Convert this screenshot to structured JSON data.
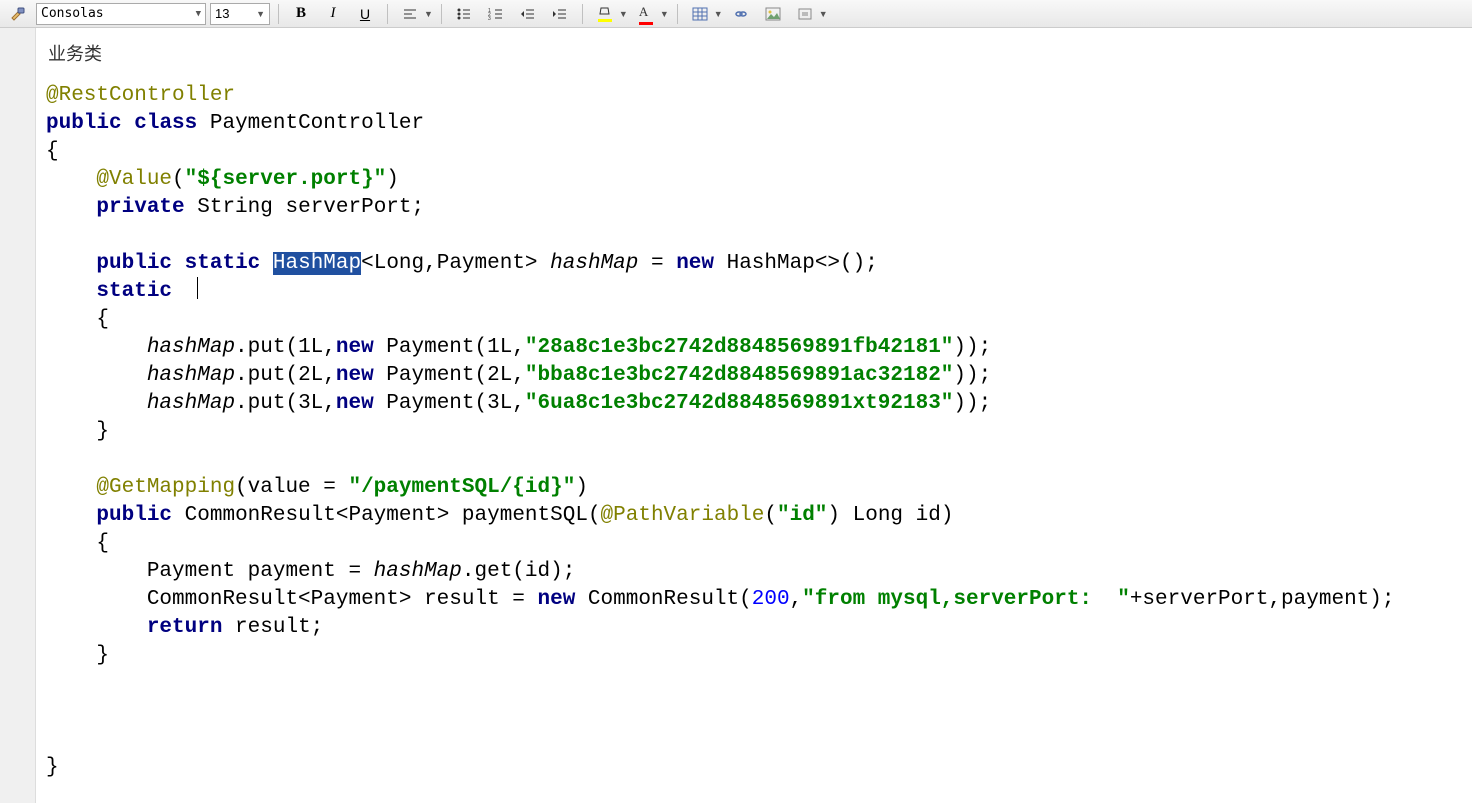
{
  "toolbar": {
    "font": "Consolas",
    "size": "13",
    "bold": "B",
    "italic": "I",
    "underline": "U"
  },
  "tab": "业务类",
  "code": {
    "annotation_rest": "@RestController",
    "kw_public": "public",
    "kw_class": "class",
    "class_name": "PaymentController",
    "brace_open": "{",
    "annotation_value": "@Value",
    "value_arg_open": "(",
    "value_str": "\"${server.port}\"",
    "value_arg_close": ")",
    "kw_private": "private",
    "type_string": "String",
    "field_serverPort": "serverPort;",
    "kw_static": "static",
    "type_hashmap": "HashMap",
    "generic": "<Long,Payment>",
    "field_hashmap": "hashMap",
    "eq_new": " = ",
    "kw_new": "new",
    "hashmap_ctor": " HashMap<>();",
    "kw_static2": "static",
    "hm_put_prefix": ".put(",
    "l1_key": "1L,",
    "l1_ctor": " Payment(1L,",
    "l1_str": "\"28a8c1e3bc2742d8848569891fb42181\"",
    "l1_end": "));",
    "l2_key": "2L,",
    "l2_ctor": " Payment(2L,",
    "l2_str": "\"bba8c1e3bc2742d8848569891ac32182\"",
    "l2_end": "));",
    "l3_key": "3L,",
    "l3_ctor": " Payment(3L,",
    "l3_str": "\"6ua8c1e3bc2742d8848569891xt92183\"",
    "l3_end": "));",
    "brace_close": "}",
    "annotation_get": "@GetMapping",
    "get_arg_open": "(value = ",
    "get_str": "\"/paymentSQL/{id}\"",
    "get_arg_close": ")",
    "ret_type": "CommonResult<Payment>",
    "method_name": "paymentSQL(",
    "annotation_path": "@PathVariable",
    "path_arg_open": "(",
    "path_str": "\"id\"",
    "path_arg_close": ") Long id)",
    "body_l1a": "Payment payment = ",
    "body_l1b": ".get(id);",
    "body_l2a": "CommonResult<Payment> result = ",
    "body_l2b": " CommonResult(",
    "body_l2_num": "200",
    "body_l2c": ",",
    "body_l2_str": "\"from mysql,serverPort:  \"",
    "body_l2d": "+serverPort,payment);",
    "kw_return": "return",
    "return_expr": " result;"
  }
}
